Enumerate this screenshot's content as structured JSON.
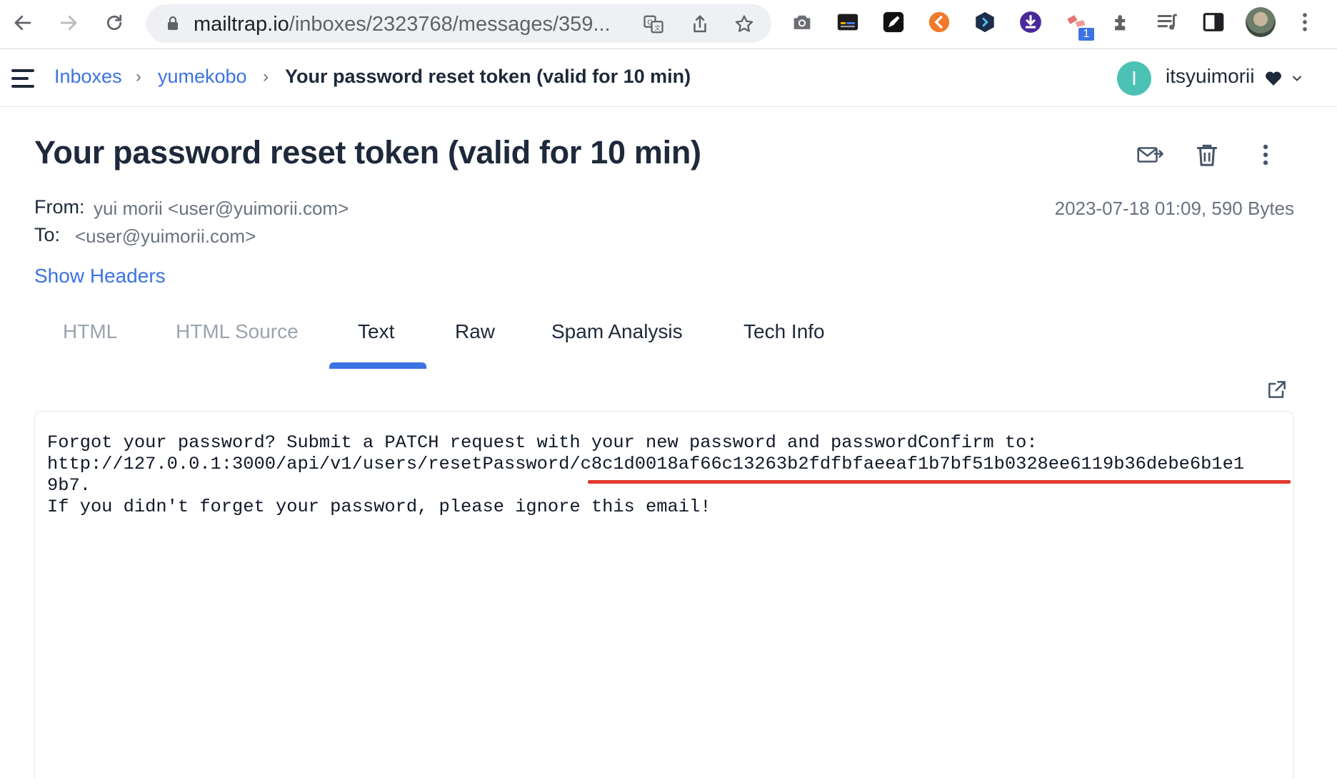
{
  "browser": {
    "url_host": "mailtrap.io",
    "url_path": "/inboxes/2323768/messages/359...",
    "extension_badge": "1",
    "icons": [
      "back-arrow-icon",
      "forward-arrow-icon",
      "reload-icon",
      "lock-icon",
      "translate-icon",
      "share-icon",
      "bookmark-star-icon",
      "camera-icon",
      "extension-dark-icon",
      "extension-pen-icon",
      "extension-orange-icon",
      "extension-hex-icon",
      "extension-download-icon",
      "extension-red-icon",
      "puzzle-icon",
      "reading-list-icon",
      "side-panel-icon",
      "profile-avatar",
      "kebab-menu-icon"
    ]
  },
  "breadcrumb": {
    "inboxes": "Inboxes",
    "inbox_name": "yumekobo",
    "current": "Your password reset token (valid for 10 min)",
    "separator": "›"
  },
  "user": {
    "initial": "I",
    "name": "itsyuimorii",
    "avatar_color": "#4cc2b5"
  },
  "message": {
    "subject": "Your password reset token (valid for 10 min)",
    "from_label": "From:",
    "from_value": "yui morii <user@yuimorii.com>",
    "to_label": "To:",
    "to_value": "<user@yuimorii.com>",
    "date_size": "2023-07-18 01:09, 590 Bytes",
    "show_headers": "Show Headers"
  },
  "tabs": {
    "items": [
      {
        "label": "HTML",
        "state": "disabled"
      },
      {
        "label": "HTML Source",
        "state": "disabled"
      },
      {
        "label": "Text",
        "state": "active"
      },
      {
        "label": "Raw",
        "state": "normal"
      },
      {
        "label": "Spam Analysis",
        "state": "normal"
      },
      {
        "label": "Tech Info",
        "state": "normal"
      }
    ]
  },
  "body": {
    "line1": "Forgot your password? Submit a PATCH request with your new password and passwordConfirm to:",
    "line2": "http://127.0.0.1:3000/api/v1/users/resetPassword/c8c1d0018af66c13263b2fdfbfaeeaf1b7bf51b0328ee6119b36debe6b1e1",
    "line3": "9b7.",
    "line4": "If you didn't forget your password, please ignore this email!",
    "highlight_color": "#e0392e"
  },
  "colors": {
    "accent": "#3b73e3",
    "text_dark": "#1e293b",
    "text_muted": "#6b7280"
  }
}
